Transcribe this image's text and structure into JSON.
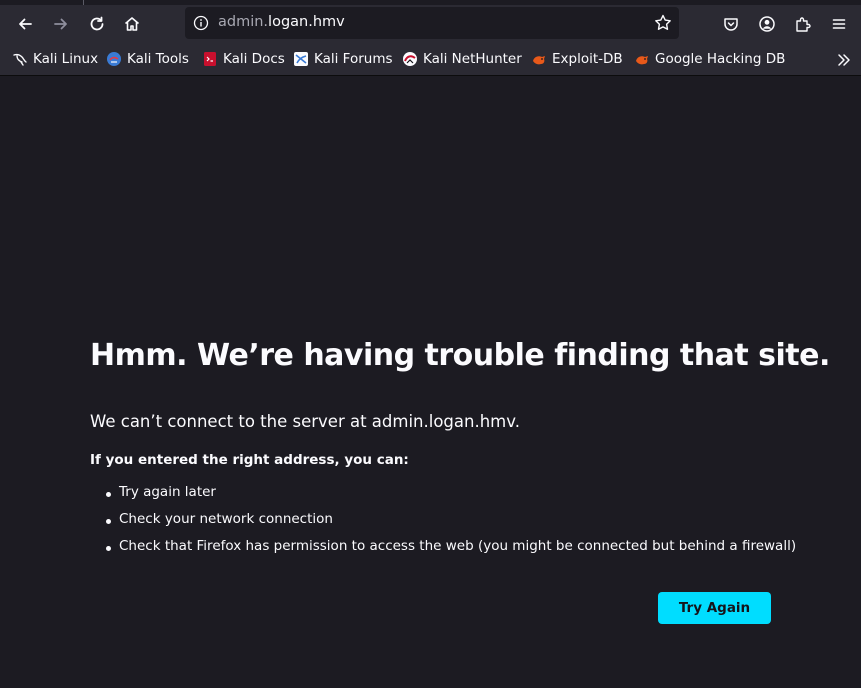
{
  "browser": {
    "url_prefix": "admin.",
    "url_domain": "logan.hmv"
  },
  "bookmarks": [
    {
      "label": "Kali Linux",
      "icon": "kali-dragon-icon"
    },
    {
      "label": "Kali Tools",
      "icon": "kali-tools-icon"
    },
    {
      "label": "Kali Docs",
      "icon": "kali-docs-icon"
    },
    {
      "label": "Kali Forums",
      "icon": "kali-forums-icon"
    },
    {
      "label": "Kali NetHunter",
      "icon": "kali-nethunter-icon"
    },
    {
      "label": "Exploit-DB",
      "icon": "exploit-db-icon"
    },
    {
      "label": "Google Hacking DB",
      "icon": "google-hacking-db-icon"
    }
  ],
  "error": {
    "title": "Hmm. We’re having trouble finding that site.",
    "description": "We can’t connect to the server at admin.logan.hmv.",
    "subtitle": "If you entered the right address, you can:",
    "suggestions": [
      "Try again later",
      "Check your network connection",
      "Check that Firefox has permission to access the web (you might be connected but behind a firewall)"
    ],
    "try_again_label": "Try Again"
  },
  "colors": {
    "toolbar_bg": "#2b2a33",
    "page_bg": "#1c1b22",
    "accent": "#00ddff"
  }
}
